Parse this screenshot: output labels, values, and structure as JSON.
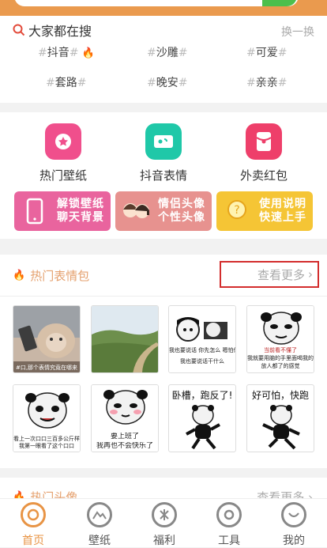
{
  "hot_search": {
    "title": "大家都在搜",
    "refresh": "换一换",
    "tags": [
      "抖音",
      "沙雕",
      "可爱",
      "套路",
      "晚安",
      "亲亲"
    ]
  },
  "features": [
    {
      "label": "热门壁纸",
      "color": "#f04f8c",
      "icon": "wallpaper-icon"
    },
    {
      "label": "抖音表情",
      "color": "#1fc8a8",
      "icon": "ticket-icon"
    },
    {
      "label": "外卖红包",
      "color": "#ee3f6a",
      "icon": "red-envelope-icon"
    }
  ],
  "banners": [
    {
      "line1": "解锁壁纸",
      "line2": "聊天背景",
      "color": "#e9649e",
      "icon": "phone-icon"
    },
    {
      "line1": "情侣头像",
      "line2": "个性头像",
      "color": "#e7928f",
      "icon": "couple-icon"
    },
    {
      "line1": "使用说明",
      "line2": "快速上手",
      "color": "#f5c535",
      "icon": "help-icon"
    }
  ],
  "stickers_section": {
    "title": "热门表情包",
    "more": "查看更多",
    "items": [
      {
        "caption": "#口,那个表情究竟在哪来"
      },
      {
        "caption": ""
      },
      {
        "caption": "我也要说话 你先怎么 嗯怕你喊",
        "caption2": "我也要说话干什么"
      },
      {
        "caption": "当前看不懂了",
        "caption2": "我就要用脑的手里面喝我的啊",
        "caption3": "放人都了的感觉"
      },
      {
        "caption": "看上一次口口三百多公斤样的",
        "caption2": "我第一眼看了这个口口"
      },
      {
        "caption": "要上班了",
        "caption2": "我再也不会快乐了"
      },
      {
        "caption": "卧槽，跑反了!"
      },
      {
        "caption": "好可怕，快跑"
      }
    ]
  },
  "avatars_section": {
    "title": "热门头像",
    "more": "查看更多"
  },
  "nav": [
    {
      "label": "首页",
      "icon": "home-icon",
      "active": true
    },
    {
      "label": "壁纸",
      "icon": "mountain-icon",
      "active": false
    },
    {
      "label": "福利",
      "icon": "gift-icon",
      "active": false
    },
    {
      "label": "工具",
      "icon": "tools-icon",
      "active": false
    },
    {
      "label": "我的",
      "icon": "profile-icon",
      "active": false
    }
  ],
  "colors": {
    "accent": "#e89445",
    "highlight_box": "#d32d2d"
  }
}
